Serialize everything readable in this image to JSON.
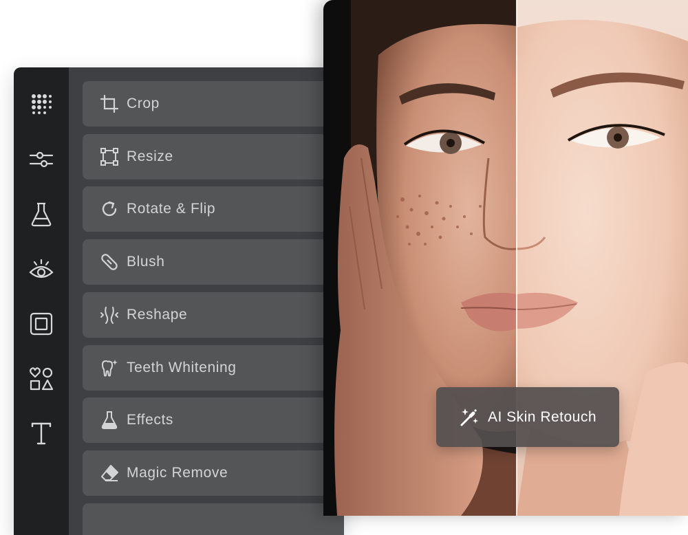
{
  "sidebar": {
    "icons": [
      "apps-grid-icon",
      "sliders-adjust-icon",
      "flask-lab-icon",
      "eye-icon",
      "frame-icon",
      "shapes-icon",
      "text-icon"
    ]
  },
  "tools": [
    {
      "label": "Crop",
      "icon": "crop-icon"
    },
    {
      "label": "Resize",
      "icon": "resize-icon"
    },
    {
      "label": "Rotate & Flip",
      "icon": "rotate-icon"
    },
    {
      "label": "Blush",
      "icon": "blush-icon"
    },
    {
      "label": "Reshape",
      "icon": "reshape-icon"
    },
    {
      "label": "Teeth Whitening",
      "icon": "tooth-sparkle-icon"
    },
    {
      "label": "Effects",
      "icon": "flask-icon"
    },
    {
      "label": "Magic Remove",
      "icon": "eraser-icon"
    }
  ],
  "badge": {
    "label": "AI Skin Retouch",
    "icon": "magic-wand-sparkle-icon"
  },
  "colors": {
    "rail_bg": "#1f2022",
    "panel_bg": "#3f4043",
    "tool_bg": "#545557",
    "tool_text": "#d4d4d6"
  }
}
